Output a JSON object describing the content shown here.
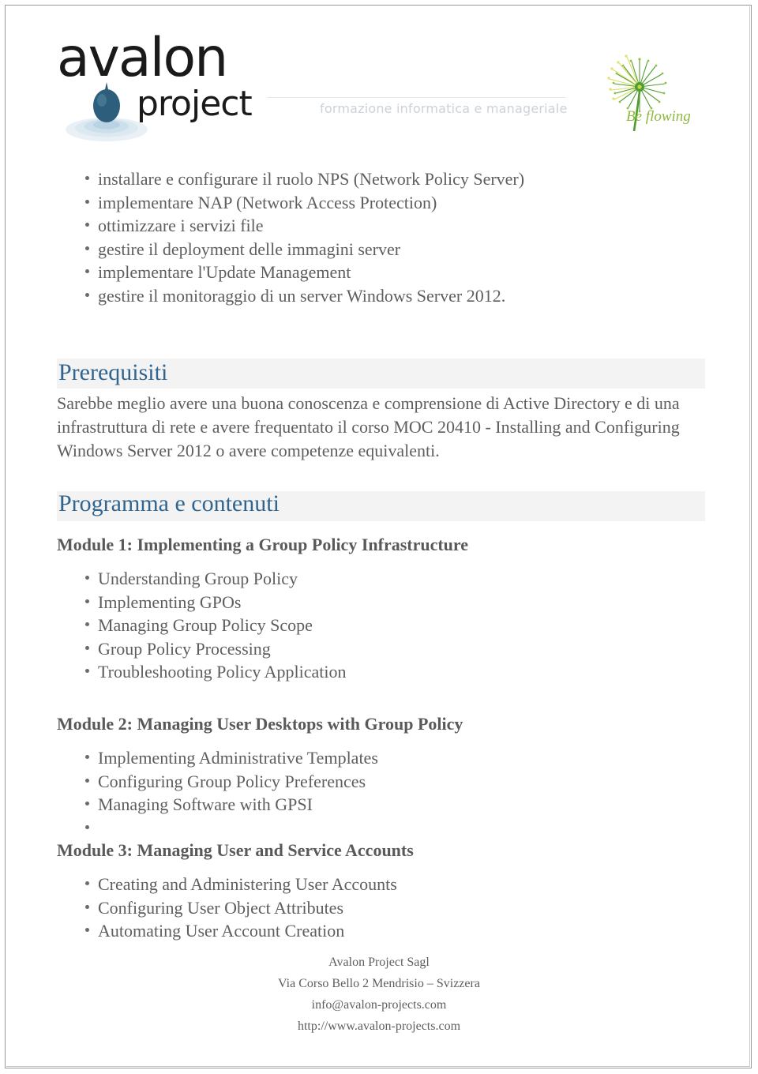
{
  "header": {
    "logo_primary_word": "avalon",
    "logo_secondary_word": "project",
    "logo_icon": "water-drop-ripple-icon",
    "tagline": "formazione informatica e manageriale",
    "partner_logo_text": "Be flowing",
    "partner_logo_icon": "dandelion-icon",
    "colors": {
      "logo_text": "#1a1a1a",
      "drop": "#2d5f7c",
      "ripple": "#cfe0ea",
      "tagline": "#ccd2d8",
      "dandelion_green": "#4f9c2f",
      "dandelion_yellow": "#d9dd5b",
      "beflowing_text": "#8fb83f"
    }
  },
  "intro_objectives": [
    "installare e configurare il ruolo NPS (Network Policy Server)",
    "implementare NAP (Network Access Protection)",
    "ottimizzare i servizi file",
    "gestire il deployment delle immagini server",
    "implementare l'Update Management",
    "gestire il monitoraggio di un server Windows Server 2012."
  ],
  "prerequisiti": {
    "heading": "Prerequisiti",
    "body": "Sarebbe meglio avere una buona conoscenza e comprensione di Active Directory e di una infrastruttura di rete e avere frequentato il corso MOC 20410 - Installing and Configuring Windows Server 2012 o avere competenze equivalenti."
  },
  "programma": {
    "heading": "Programma e contenuti",
    "modules": [
      {
        "title": "Module 1: Implementing a Group Policy Infrastructure",
        "topics": [
          "Understanding Group Policy",
          "Implementing GPOs",
          "Managing Group Policy Scope",
          "Group Policy Processing",
          "Troubleshooting Policy Application"
        ]
      },
      {
        "title": "Module 2: Managing User Desktops with Group Policy",
        "topics": [
          "Implementing Administrative Templates",
          "Configuring Group Policy Preferences",
          "Managing Software with GPSI",
          ""
        ]
      },
      {
        "title": "Module 3: Managing User and Service Accounts",
        "topics": [
          "Creating and Administering User Accounts",
          "Configuring User Object Attributes",
          "Automating User Account Creation"
        ]
      }
    ]
  },
  "footer": {
    "company": "Avalon Project Sagl",
    "address": "Via Corso Bello 2 Mendrisio – Svizzera",
    "email": "info@avalon-projects.com",
    "website": "http://www.avalon-projects.com"
  },
  "theme": {
    "heading_color": "#31658f",
    "body_color": "#5e5e5e",
    "band_color": "#f3f3f3",
    "page_border": "#9a9a9a"
  }
}
